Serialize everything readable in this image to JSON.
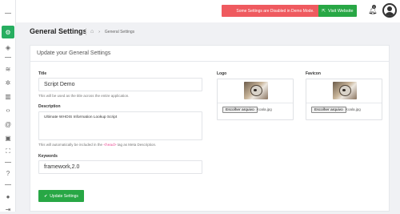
{
  "sidebar": {
    "items": [
      {
        "icon": "gear-icon",
        "glyph": "⚙"
      },
      {
        "icon": "shield-icon",
        "glyph": "◈"
      },
      {
        "icon": "layers-icon",
        "glyph": "≋"
      },
      {
        "icon": "cogs-icon",
        "glyph": "✲"
      },
      {
        "icon": "bar-chart-icon",
        "glyph": "▥"
      },
      {
        "icon": "code-icon",
        "glyph": "‹›"
      },
      {
        "icon": "at-icon",
        "glyph": "@"
      },
      {
        "icon": "lock-icon",
        "glyph": "▣"
      },
      {
        "icon": "expand-icon",
        "glyph": "⛶"
      },
      {
        "icon": "help-icon",
        "glyph": "?"
      },
      {
        "icon": "user-icon",
        "glyph": "●"
      },
      {
        "icon": "logout-icon",
        "glyph": "⇥"
      }
    ]
  },
  "topbar": {
    "demo_notice": "Some Settings are Disabled in Demo Mode.",
    "visit_label": "Visit Website",
    "visit_icon": "external-link-icon",
    "notification_count": "0"
  },
  "header": {
    "title": "General Settings",
    "breadcrumb": "General Settings"
  },
  "card": {
    "title": "Update your General Settings",
    "title_field": {
      "label": "Title",
      "value": "Script Demo",
      "help": "This will be used as the title across the entire application."
    },
    "description_field": {
      "label": "Description",
      "value": "Ultimate WHOIS Information Lookup Script",
      "help_before": "This will automatically be included in the",
      "help_code": "<head>",
      "help_after": "tag as Meta Description."
    },
    "keywords_field": {
      "label": "Keywords",
      "value": "framework,2.0"
    },
    "logo": {
      "label": "Logo",
      "button": "Escolher arquivo",
      "file": "Koala.jpg"
    },
    "favicon": {
      "label": "Favicon",
      "button": "Escolher arquivo",
      "file": "Koala.jpg"
    },
    "save_label": "Update Settings"
  },
  "colors": {
    "accent": "#28a745",
    "danger": "#ef5a5f"
  }
}
